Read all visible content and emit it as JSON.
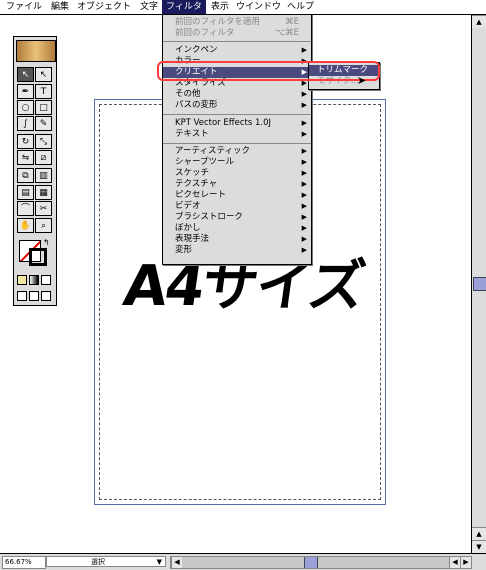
{
  "menubar": {
    "items": [
      {
        "label": "ファイル"
      },
      {
        "label": "編集"
      },
      {
        "label": "オブジェクト"
      },
      {
        "label": "文字"
      },
      {
        "label": "フィルタ"
      },
      {
        "label": "表示"
      },
      {
        "label": "ウインドウ"
      },
      {
        "label": "ヘルプ"
      }
    ]
  },
  "filter_menu": {
    "top_items": [
      {
        "label": "前回のフィルタを適用",
        "shortcut": "⌘E"
      },
      {
        "label": "前回のフィルタ",
        "shortcut": "⌥⌘E"
      }
    ],
    "group1": [
      {
        "label": "インクペン"
      },
      {
        "label": "カラー"
      },
      {
        "label": "クリエイト"
      },
      {
        "label": "スタイライズ"
      },
      {
        "label": "その他"
      },
      {
        "label": "パスの変形"
      }
    ],
    "group2": [
      {
        "label": "KPT Vector Effects 1.0J"
      },
      {
        "label": "テキスト"
      }
    ],
    "group3": [
      {
        "label": "アーティスティック"
      },
      {
        "label": "シャープツール"
      },
      {
        "label": "スケッチ"
      },
      {
        "label": "テクスチャ"
      },
      {
        "label": "ピクセレート"
      },
      {
        "label": "ビデオ"
      },
      {
        "label": "ブラシストローク"
      },
      {
        "label": "ぼかし"
      },
      {
        "label": "表現手法"
      },
      {
        "label": "変形"
      }
    ]
  },
  "submenu": {
    "items": [
      {
        "label": "トリムマーク"
      },
      {
        "label": "モザイク..."
      }
    ]
  },
  "document": {
    "title_text": "A4サイズ"
  },
  "statusbar": {
    "zoom": "66.67%",
    "mode": "選択"
  },
  "colors": {
    "menu_highlight": "#4a4a7e",
    "annotation_ring": "#ff3b3b",
    "page_border": "#5a6aa8"
  },
  "icons": {
    "toolbox": [
      "selection-icon",
      "direct-selection-icon",
      "pen-icon",
      "type-icon",
      "ellipse-icon",
      "rectangle-icon",
      "paintbrush-icon",
      "pencil-icon",
      "rotate-icon",
      "scale-icon",
      "reflect-icon",
      "shear-icon",
      "blend-icon",
      "graph-icon",
      "gradient-icon",
      "mesh-icon",
      "eyedropper-icon",
      "scissors-icon",
      "hand-icon",
      "zoom-icon"
    ]
  }
}
